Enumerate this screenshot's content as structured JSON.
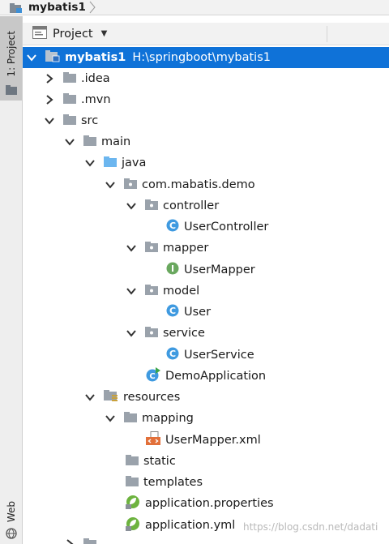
{
  "breadcrumb": {
    "project": "mybatis1"
  },
  "tool_strip": {
    "project_tab": "1: Project",
    "web_tab": "Web"
  },
  "panel": {
    "title": "Project"
  },
  "tree": {
    "root": {
      "name": "mybatis1",
      "path": "H:\\springboot\\mybatis1"
    },
    "idea": ".idea",
    "mvn": ".mvn",
    "src": "src",
    "main": "main",
    "java": "java",
    "package": "com.mabatis.demo",
    "controller": "controller",
    "user_controller": "UserController",
    "mapper": "mapper",
    "user_mapper": "UserMapper",
    "model": "model",
    "user": "User",
    "service": "service",
    "user_service": "UserService",
    "demo_application": "DemoApplication",
    "resources": "resources",
    "mapping": "mapping",
    "user_mapper_xml": "UserMapper.xml",
    "static": "static",
    "templates": "templates",
    "app_properties": "application.properties",
    "app_yml": "application.yml"
  },
  "watermark": "https://blog.csdn.net/dadati",
  "colors": {
    "selection": "#0f72d8",
    "folder": "#9aa2ab",
    "source_folder": "#6cb6ef",
    "class_badge": "#3f9ae0",
    "interface_badge": "#6aa85f",
    "spring_leaf": "#6db33f"
  },
  "icons": {
    "module": "module-folder-icon",
    "folder": "folder-icon",
    "package": "package-icon",
    "class": "class-icon",
    "interface": "interface-icon",
    "spring_app": "spring-boot-app-icon",
    "resources": "resources-folder-icon",
    "xml": "xml-file-icon",
    "config": "spring-config-icon"
  }
}
